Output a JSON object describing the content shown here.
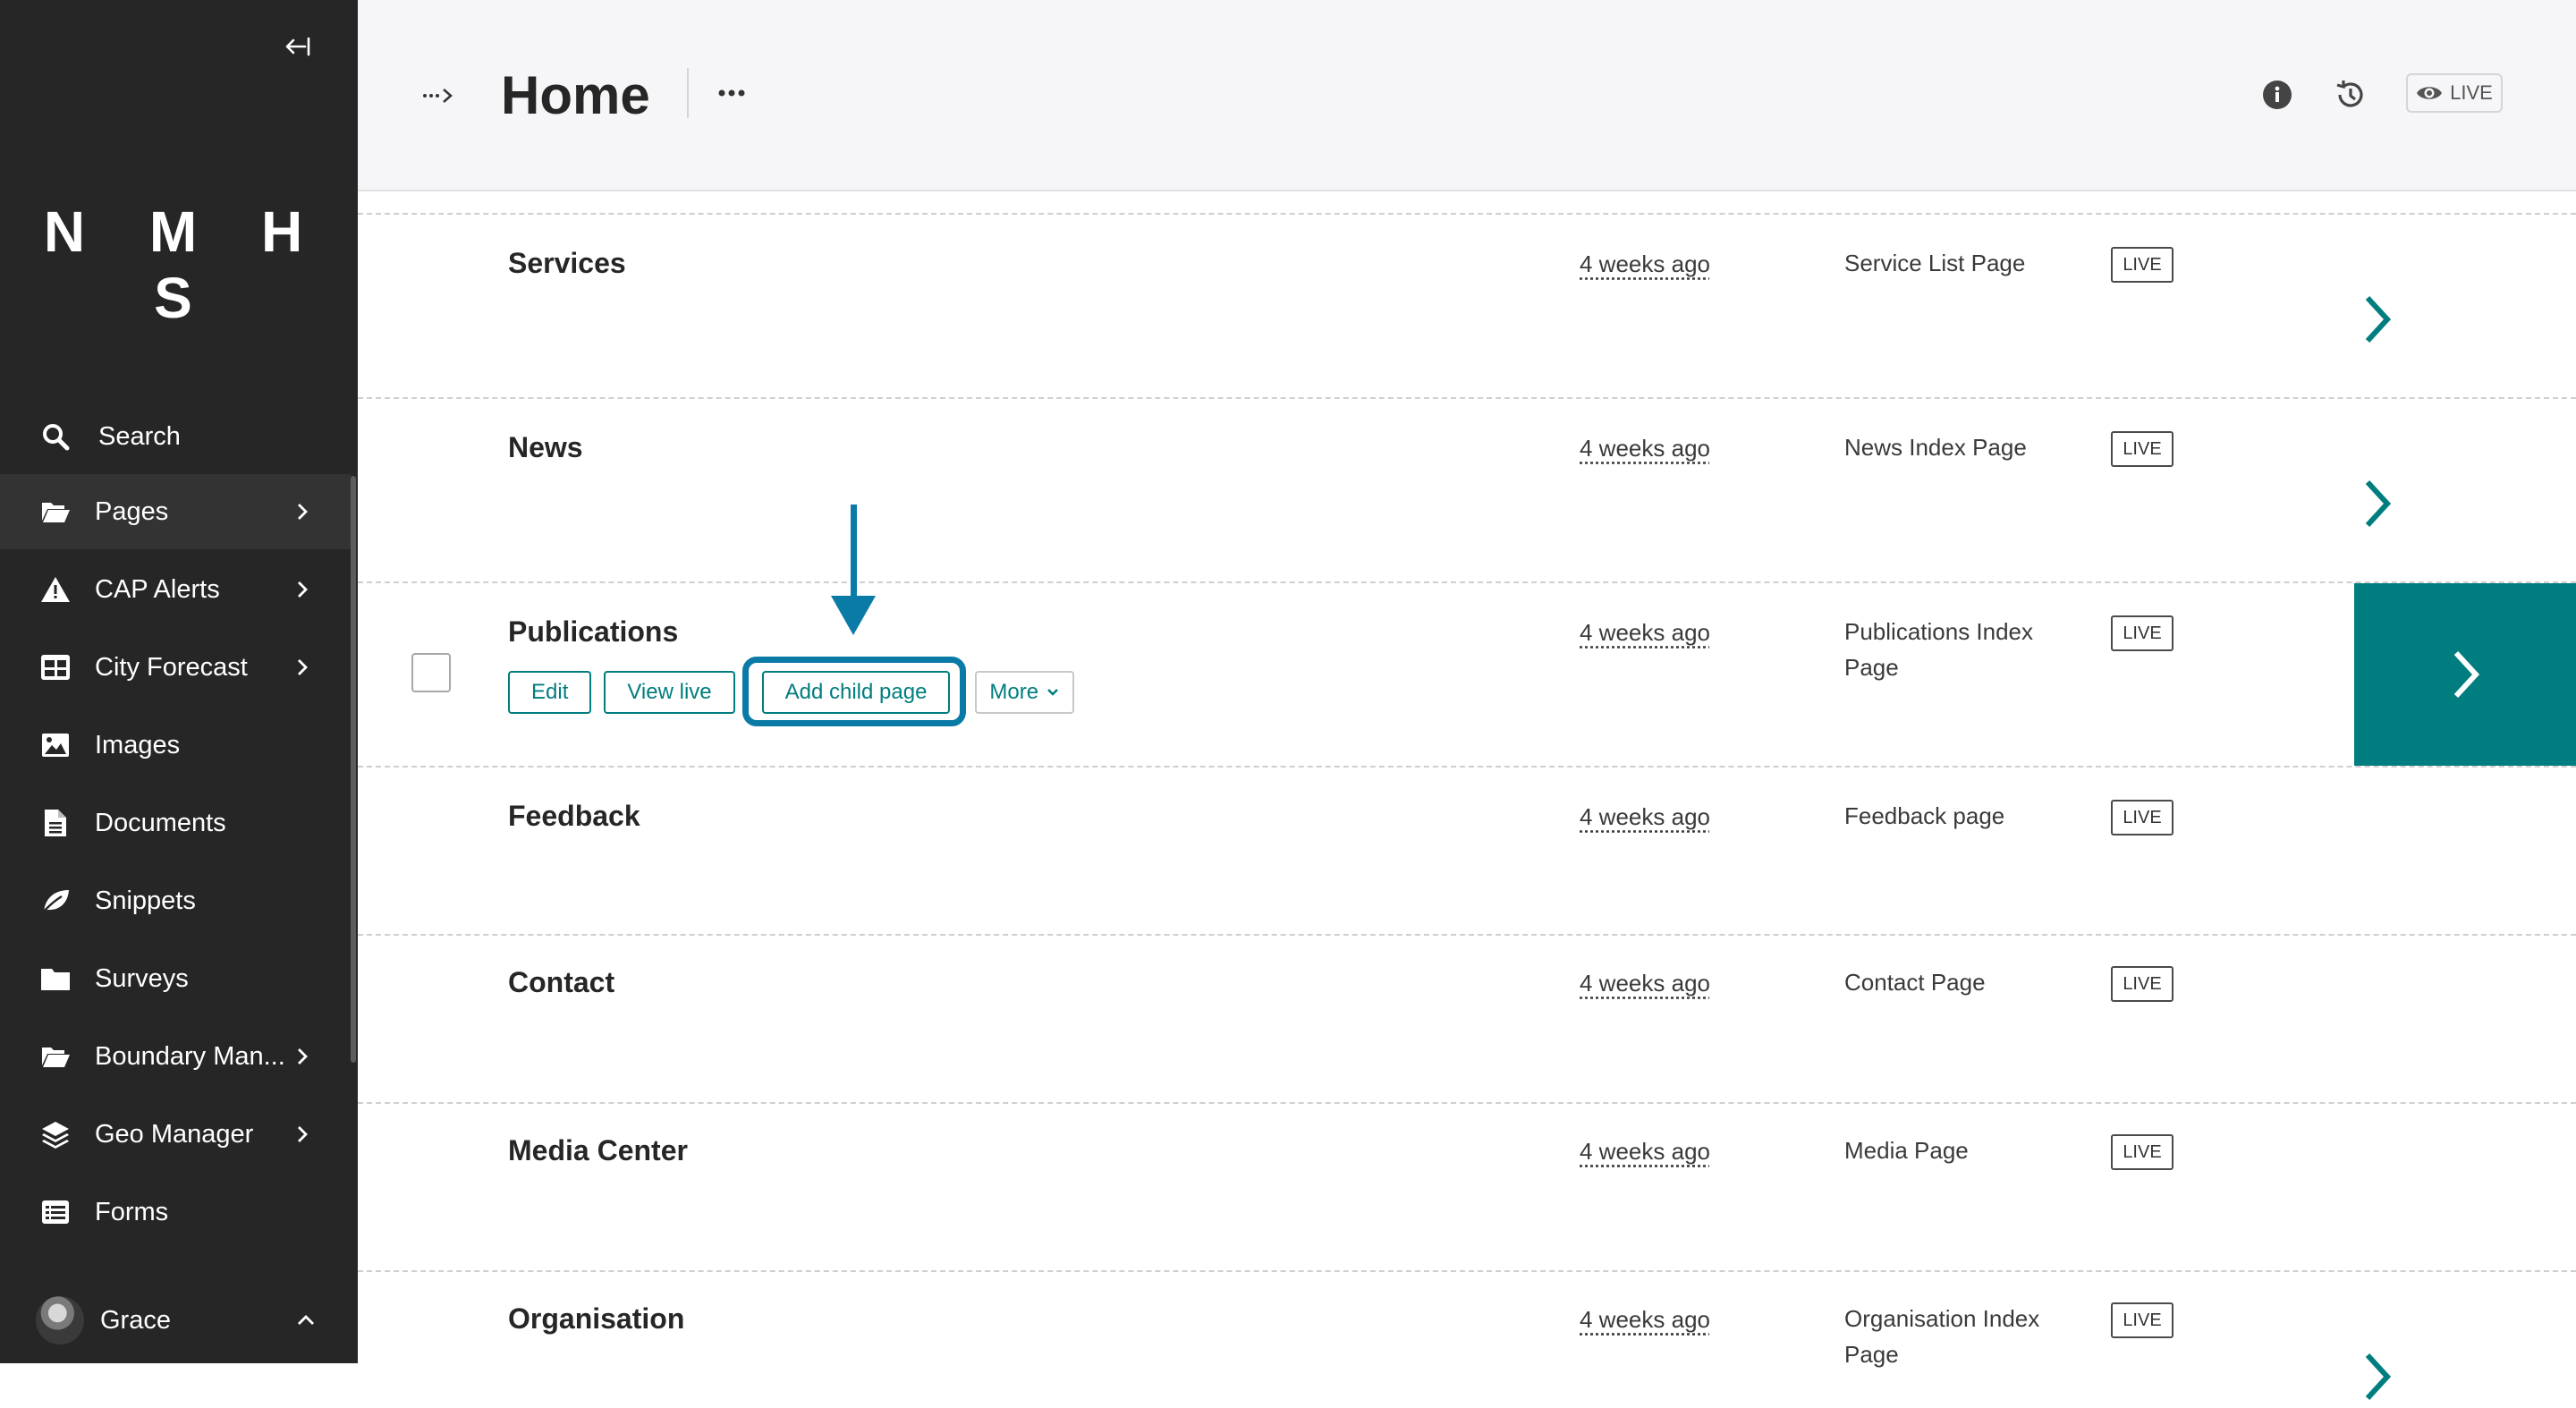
{
  "sidebar": {
    "logo": "N M H S",
    "items": [
      {
        "label": "Search",
        "icon": "search-icon"
      },
      {
        "label": "Pages",
        "icon": "folder-open-icon"
      },
      {
        "label": "CAP Alerts",
        "icon": "warning-icon"
      },
      {
        "label": "City Forecast",
        "icon": "table-icon"
      },
      {
        "label": "Images",
        "icon": "image-icon"
      },
      {
        "label": "Documents",
        "icon": "document-icon"
      },
      {
        "label": "Snippets",
        "icon": "leaf-icon"
      },
      {
        "label": "Surveys",
        "icon": "folder-icon"
      },
      {
        "label": "Boundary Man...",
        "icon": "folder-open-icon"
      },
      {
        "label": "Geo Manager",
        "icon": "layers-icon"
      },
      {
        "label": "Forms",
        "icon": "list-icon"
      }
    ],
    "account_name": "Grace"
  },
  "header": {
    "title": "Home",
    "status_label": "LIVE"
  },
  "rows": [
    {
      "title": "Services",
      "updated": "4 weeks ago",
      "type": "Service List Page",
      "status": "LIVE"
    },
    {
      "title": "News",
      "updated": "4 weeks ago",
      "type": "News Index Page",
      "status": "LIVE"
    },
    {
      "title": "Publications",
      "updated": "4 weeks ago",
      "type": "Publications Index Page",
      "status": "LIVE"
    },
    {
      "title": "Feedback",
      "updated": "4 weeks ago",
      "type": "Feedback page",
      "status": "LIVE"
    },
    {
      "title": "Contact",
      "updated": "4 weeks ago",
      "type": "Contact Page",
      "status": "LIVE"
    },
    {
      "title": "Media Center",
      "updated": "4 weeks ago",
      "type": "Media Page",
      "status": "LIVE"
    },
    {
      "title": "Organisation",
      "updated": "4 weeks ago",
      "type": "Organisation Index Page",
      "status": "LIVE"
    }
  ],
  "row_actions": {
    "edit": "Edit",
    "view_live": "View live",
    "add_child": "Add child page",
    "more": "More"
  },
  "colors": {
    "sidebar_bg": "#262626",
    "accent": "#007d7e",
    "annotation": "#0a7aa6"
  }
}
